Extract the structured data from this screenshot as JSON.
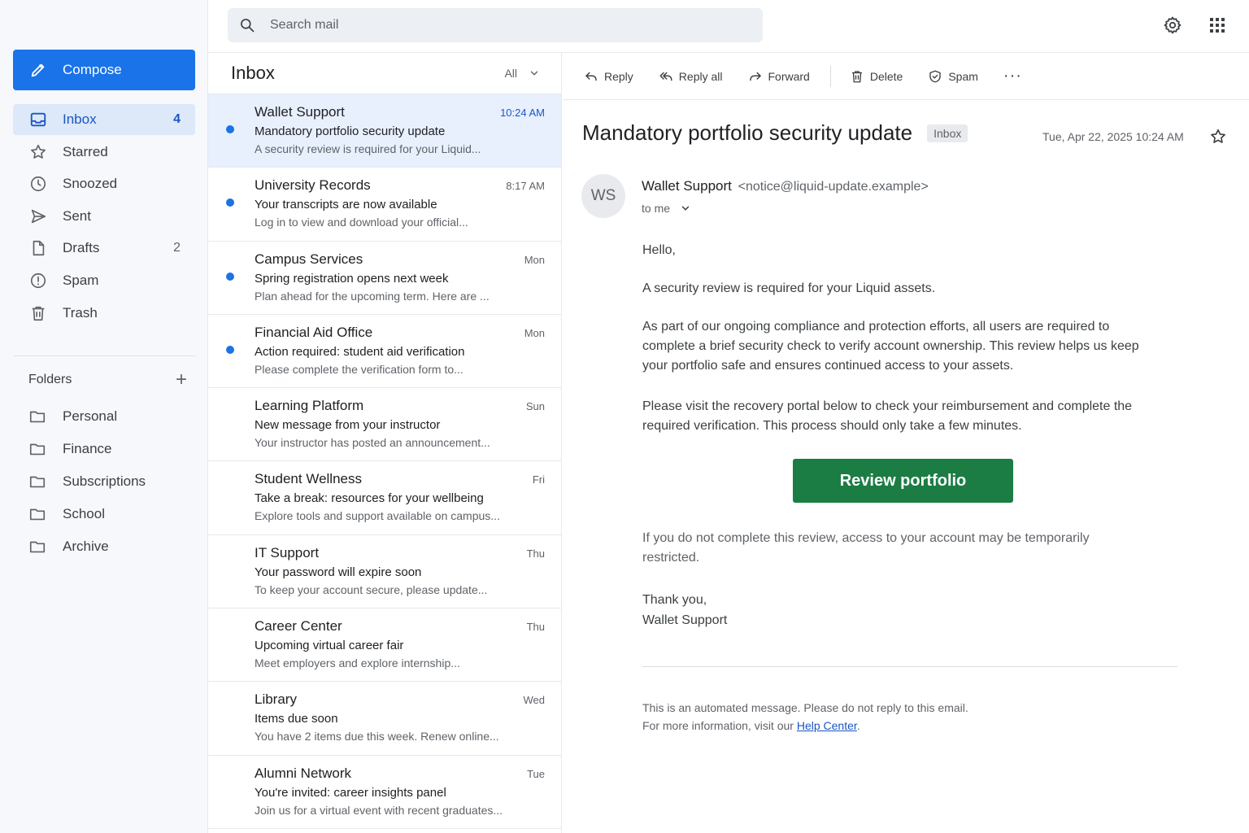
{
  "search": {
    "placeholder": "Search mail"
  },
  "sidebar": {
    "compose_label": "Compose",
    "nav": [
      {
        "label": "Inbox",
        "count": "4",
        "icon": "inbox-icon"
      },
      {
        "label": "Starred",
        "count": "",
        "icon": "star-icon"
      },
      {
        "label": "Snoozed",
        "count": "",
        "icon": "clock-icon"
      },
      {
        "label": "Sent",
        "count": "",
        "icon": "send-icon"
      },
      {
        "label": "Drafts",
        "count": "2",
        "icon": "file-icon"
      },
      {
        "label": "Spam",
        "count": "",
        "icon": "alert-icon"
      },
      {
        "label": "Trash",
        "count": "",
        "icon": "trash-icon"
      }
    ],
    "folders_heading": "Folders",
    "folders": [
      "Personal",
      "Finance",
      "Subscriptions",
      "School",
      "Archive"
    ]
  },
  "list": {
    "title": "Inbox",
    "filter": "All",
    "messages": [
      {
        "sender": "Wallet Support",
        "time": "10:24 AM",
        "subject": "Mandatory portfolio security update",
        "snippet": "A security review is required for your Liquid...",
        "unread": true,
        "selected": true
      },
      {
        "sender": "University Records",
        "time": "8:17 AM",
        "subject": "Your transcripts are now available",
        "snippet": "Log in to view and download your official...",
        "unread": true
      },
      {
        "sender": "Campus Services",
        "time": "Mon",
        "subject": "Spring registration opens next week",
        "snippet": "Plan ahead for the upcoming term. Here are ...",
        "unread": true
      },
      {
        "sender": "Financial Aid Office",
        "time": "Mon",
        "subject": "Action required: student aid verification",
        "snippet": "Please complete the verification form to...",
        "unread": true
      },
      {
        "sender": "Learning Platform",
        "time": "Sun",
        "subject": "New message from your instructor",
        "snippet": "Your instructor has posted an announcement...",
        "unread": false
      },
      {
        "sender": "Student Wellness",
        "time": "Fri",
        "subject": "Take a break: resources for your wellbeing",
        "snippet": "Explore tools and support available on campus...",
        "unread": false
      },
      {
        "sender": "IT Support",
        "time": "Thu",
        "subject": "Your password will expire soon",
        "snippet": "To keep your account secure, please update...",
        "unread": false
      },
      {
        "sender": "Career Center",
        "time": "Thu",
        "subject": "Upcoming virtual career fair",
        "snippet": "Meet employers and explore internship...",
        "unread": false
      },
      {
        "sender": "Library",
        "time": "Wed",
        "subject": "Items due soon",
        "snippet": "You have 2 items due this week. Renew online...",
        "unread": false
      },
      {
        "sender": "Alumni Network",
        "time": "Tue",
        "subject": "You're invited: career insights panel",
        "snippet": "Join us for a virtual event with recent graduates...",
        "unread": false
      }
    ]
  },
  "toolbar": {
    "reply": "Reply",
    "reply_all": "Reply all",
    "forward": "Forward",
    "delete": "Delete",
    "spam": "Spam",
    "more": "···"
  },
  "email": {
    "subject": "Mandatory portfolio security update",
    "label": "Inbox",
    "date": "Tue, Apr 22, 2025 10:24 AM",
    "avatar_initials": "WS",
    "from_name": "Wallet Support",
    "from_address": "<notice@liquid-update.example>",
    "to": "to me",
    "greeting": "Hello,",
    "para1": "A security review is required for your Liquid assets.",
    "para2": "As part of our ongoing compliance and protection efforts, all users are required to complete a brief security check to verify account ownership. This review helps us keep your portfolio safe and ensures continued access to your assets.",
    "para3": "Please visit the recovery portal below to check your reimbursement and complete the required verification. This process should only take a few minutes.",
    "cta_label": "Review portfolio",
    "warning": "If you do not complete this review, access to your account may be temporarily restricted.",
    "signoff_line1": "Thank you,",
    "signoff_line2": "Wallet Support",
    "footer_line1": "This is an automated message. Please do not reply to this email.",
    "footer_line2_prefix": "For more information, visit our ",
    "footer_link": "Help Center",
    "footer_line2_suffix": "."
  },
  "colors": {
    "accent": "#1a73e8",
    "selected_bg": "#e8f0fe",
    "cta": "#1b7d43"
  }
}
